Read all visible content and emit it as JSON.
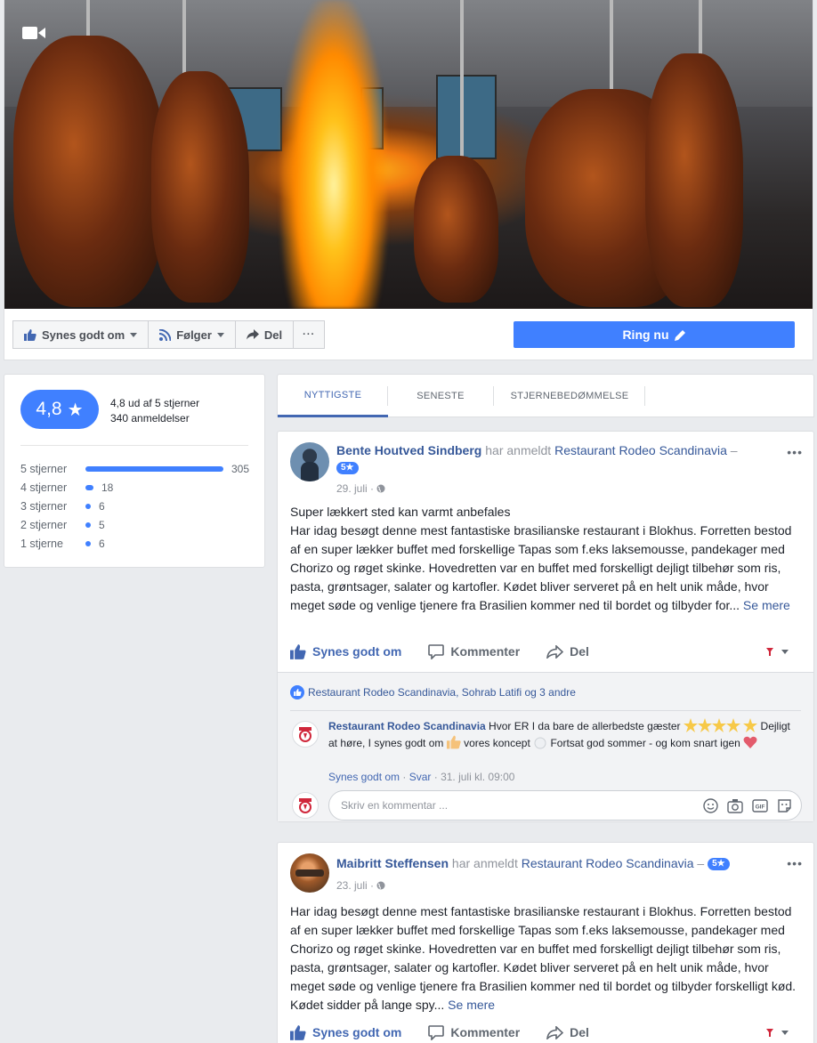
{
  "cover": {
    "video_icon": "video-camera-icon"
  },
  "actions": {
    "like_label": "Synes godt om",
    "follow_label": "Følger",
    "share_label": "Del",
    "more_label": "···",
    "call_label": "Ring nu"
  },
  "rating": {
    "score": "4,8",
    "summary": "4,8 ud af 5 stjerner",
    "count": "340 anmeldelser",
    "rows": [
      {
        "label": "5 stjerner",
        "count": "305",
        "value": 305
      },
      {
        "label": "4 stjerner",
        "count": "18",
        "value": 18
      },
      {
        "label": "3 stjerner",
        "count": "6",
        "value": 6
      },
      {
        "label": "2 stjerner",
        "count": "5",
        "value": 5
      },
      {
        "label": "1 stjerne",
        "count": "6",
        "value": 6
      }
    ]
  },
  "tabs": [
    "NYTTIGSTE",
    "SENESTE",
    "STJERNEBEDØMMELSE"
  ],
  "posts": [
    {
      "author": "Bente Houtved Sindberg",
      "verb": " har anmeldt ",
      "page": "Restaurant Rodeo Scandinavia",
      "dash": " –",
      "badge": "5★",
      "date": "29. juli ·",
      "title": "Super lækkert sted kan varmt anbefales",
      "body": "Har idag besøgt denne mest fantastiske brasilianske restaurant i Blokhus. Forretten bestod af en super lækker buffet med forskellige Tapas som f.eks laksemousse, pandekager med Chorizo og røget skinke. Hovedretten var en buffet med forskelligt dejligt tilbehør som ris, pasta, grøntsager, salater og kartofler. Kødet bliver serveret på en helt unik måde, hvor meget søde og venlige tjenere fra Brasilien kommer ned til bordet og tilbyder for...",
      "more": " Se mere",
      "like": "Synes godt om",
      "comment": "Kommenter",
      "share": "Del",
      "likers": "Restaurant Rodeo Scandinavia, Sohrab Latifi og 3 andre",
      "reply": {
        "author": "Restaurant Rodeo Scandinavia",
        "text1": " Hvor ER I da bare de allerbedste gæster ",
        "text2": " Dejligt at høre, I synes godt om ",
        "text3": " vores koncept ",
        "text4": " Fortsat god sommer - og kom snart igen ",
        "like": "Synes godt om",
        "answer": "Svar",
        "time": "31. juli kl. 09:00"
      },
      "comment_placeholder": "Skriv en kommentar ..."
    },
    {
      "author": "Maibritt Steffensen",
      "verb": " har anmeldt ",
      "page": "Restaurant Rodeo Scandinavia",
      "dash": " –",
      "badge": "5★",
      "date": "23. juli ·",
      "body": "Har idag besøgt denne mest fantastiske brasilianske restaurant i Blokhus. Forretten bestod af en super lækker buffet med forskellige Tapas som f.eks laksemousse, pandekager med Chorizo og røget skinke. Hovedretten var en buffet med forskelligt dejligt tilbehør som ris, pasta, grøntsager, salater og kartofler. Kødet bliver serveret på en helt unik måde, hvor meget søde og venlige tjenere fra Brasilien kommer ned til bordet og tilbyder forskelligt kød. Kødet sidder på lange spy...",
      "more": " Se mere",
      "like": "Synes godt om",
      "comment": "Kommenter",
      "share": "Del"
    }
  ],
  "colors": {
    "accent": "#4080ff",
    "link": "#365899",
    "background": "#e9ebee"
  }
}
